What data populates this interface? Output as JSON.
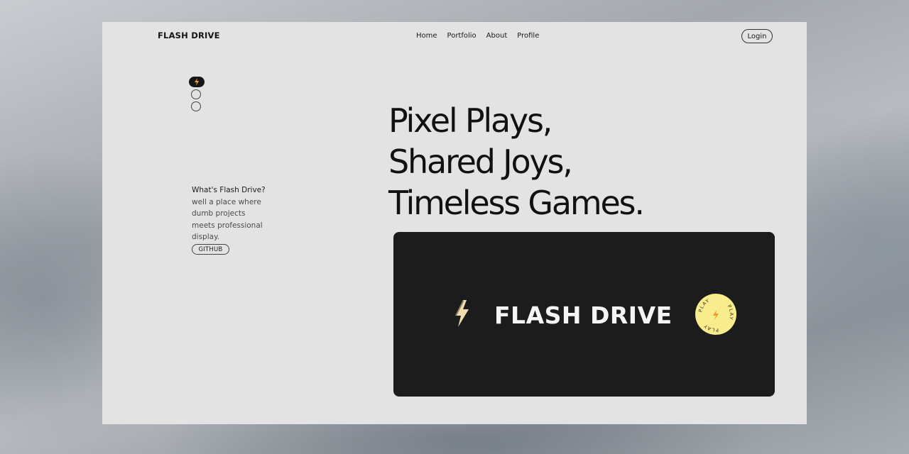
{
  "header": {
    "brand": "FLASH DRIVE",
    "nav": [
      {
        "label": "Home"
      },
      {
        "label": "Portfolio"
      },
      {
        "label": "About"
      },
      {
        "label": "Profile"
      }
    ],
    "login_label": "Login"
  },
  "slider": {
    "count": 3,
    "active_index": 0
  },
  "about": {
    "question": "What's Flash Drive?",
    "answer_lines": [
      "well a place where",
      "dumb projects",
      "meets professional",
      "display."
    ],
    "github_label": "GITHUB"
  },
  "hero": {
    "lines": [
      "Pixel Plays,",
      "Shared Joys,",
      "Timeless Games."
    ]
  },
  "card": {
    "title": "FLASH DRIVE",
    "play_label": "PLAY",
    "icon": "lightning-bolt-icon"
  },
  "colors": {
    "page_bg": "#e3e3e3",
    "card_bg": "#1c1c1c",
    "accent_yellow": "#f8ec8c",
    "accent_orange": "#f39a2b",
    "bolt_cream": "#f1ddb0"
  }
}
